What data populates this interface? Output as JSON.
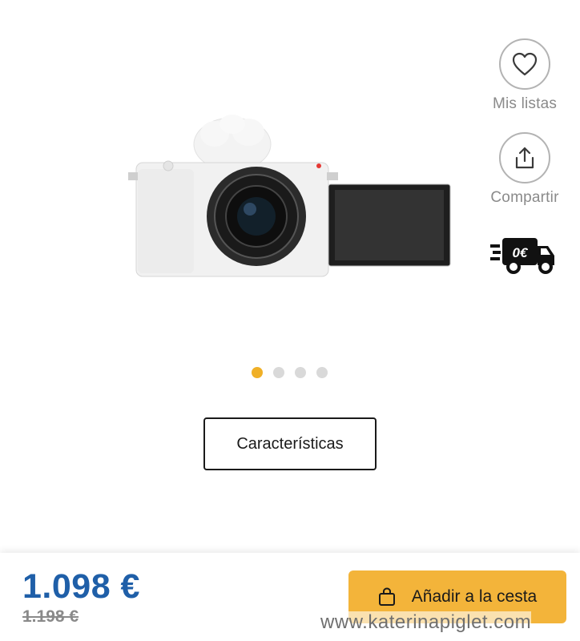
{
  "actions": {
    "wishlist_label": "Mis listas",
    "share_label": "Compartir",
    "free_shipping_badge": "0€"
  },
  "product": {
    "image_icon": "camera-image"
  },
  "carousel": {
    "total": 4,
    "active": 1
  },
  "features_label": "Características",
  "pricing": {
    "price": "1.098 €",
    "old_price": "1.198 €"
  },
  "cart": {
    "label": "Añadir a la cesta"
  },
  "watermark": "www.katerinapiglet.com",
  "colors": {
    "accent": "#f3b43a",
    "price_blue": "#1f5fa8",
    "active_dot": "#f0b027"
  }
}
